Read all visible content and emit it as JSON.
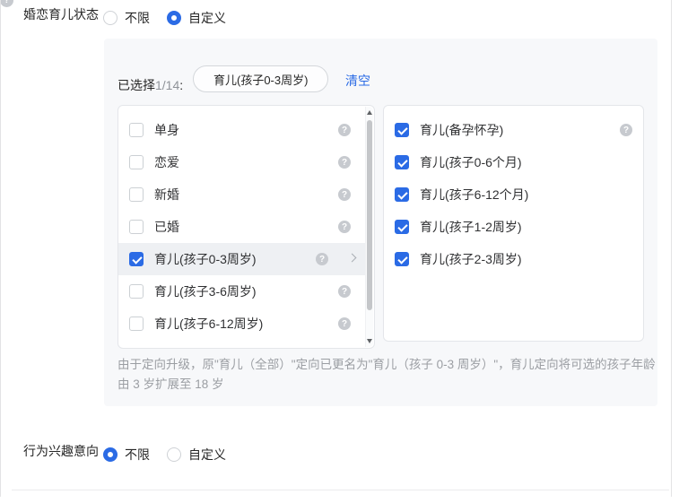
{
  "accent_blue": "#2b6be5",
  "icons": {
    "help": "?",
    "chevron_right": "chevron-right",
    "scroll_up": "triangle-up",
    "scroll_down": "triangle-down"
  },
  "section_marital": {
    "label": "婚恋育儿状态",
    "options": [
      {
        "label": "不限",
        "selected": false
      },
      {
        "label": "自定义",
        "selected": true
      }
    ]
  },
  "selection_bar": {
    "prefix": "已选择",
    "count": "1/14",
    "colon": ":",
    "tag": "育儿(孩子0-3周岁)",
    "clear": "清空"
  },
  "left_list": [
    {
      "label": "单身",
      "checked": false,
      "help": true
    },
    {
      "label": "恋爱",
      "checked": false,
      "help": true
    },
    {
      "label": "新婚",
      "checked": false,
      "help": true
    },
    {
      "label": "已婚",
      "checked": false,
      "help": true
    },
    {
      "label": "育儿(孩子0-3周岁)",
      "checked": true,
      "help": true,
      "expand": true,
      "highlight": true
    },
    {
      "label": "育儿(孩子3-6周岁)",
      "checked": false,
      "help": true
    },
    {
      "label": "育儿(孩子6-12周岁)",
      "checked": false,
      "help": true
    }
  ],
  "right_list": [
    {
      "label": "育儿(备孕怀孕)",
      "checked": true,
      "help": true
    },
    {
      "label": "育儿(孩子0-6个月)",
      "checked": true,
      "help": false
    },
    {
      "label": "育儿(孩子6-12个月)",
      "checked": true,
      "help": false
    },
    {
      "label": "育儿(孩子1-2周岁)",
      "checked": true,
      "help": false
    },
    {
      "label": "育儿(孩子2-3周岁)",
      "checked": true,
      "help": false
    }
  ],
  "note": "由于定向升级，原\"育儿（全部）\"定向已更名为\"育儿（孩子 0-3 周岁）\"，育儿定向将可选的孩子年龄由 3 岁扩展至 18 岁",
  "section_behavior": {
    "label": "行为兴趣意向",
    "options": [
      {
        "label": "不限",
        "selected": true
      },
      {
        "label": "自定义",
        "selected": false
      }
    ]
  }
}
